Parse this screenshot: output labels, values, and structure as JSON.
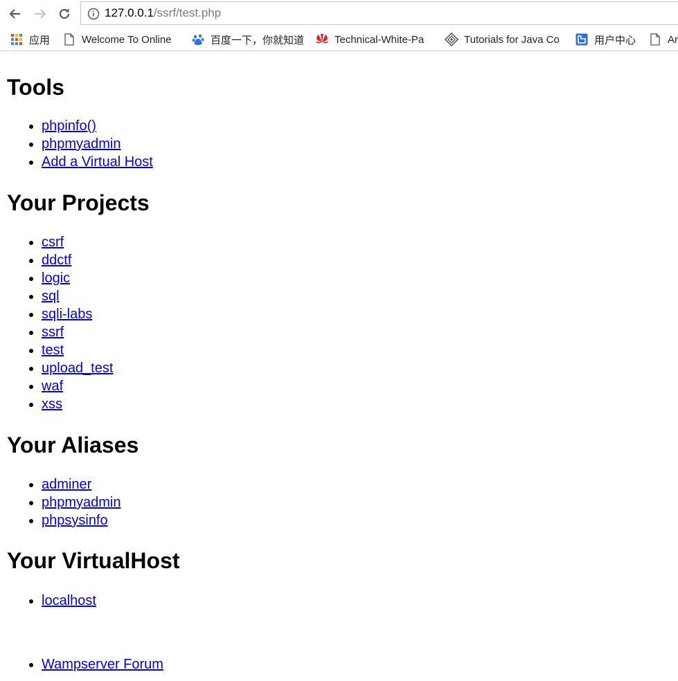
{
  "browser": {
    "url_host": "127.0.0.1",
    "url_path": "/ssrf/test.php",
    "bookmarks": [
      {
        "label": "应用",
        "icon": "apps-grid-icon"
      },
      {
        "label": "Welcome To Online",
        "icon": "page-icon"
      },
      {
        "label": "百度一下，你就知道",
        "icon": "baidu-paw-icon"
      },
      {
        "label": "Technical-White-Pa",
        "icon": "huawei-icon"
      },
      {
        "label": "Tutorials for Java Co",
        "icon": "diamond-icon"
      },
      {
        "label": "用户中心",
        "icon": "user-center-icon"
      },
      {
        "label": "Ar",
        "icon": "page-icon"
      }
    ]
  },
  "page": {
    "tools_heading": "Tools",
    "tools": [
      "phpinfo()",
      "phpmyadmin",
      "Add a Virtual Host"
    ],
    "projects_heading": "Your Projects",
    "projects": [
      "csrf",
      "ddctf",
      "logic",
      "sql",
      "sqli-labs",
      "ssrf",
      "test",
      "upload_test",
      "waf",
      "xss"
    ],
    "aliases_heading": "Your Aliases",
    "aliases": [
      "adminer",
      "phpmyadmin",
      "phpsysinfo"
    ],
    "vhost_heading": "Your VirtualHost",
    "vhosts": [
      "localhost"
    ],
    "forum": "Wampserver Forum"
  },
  "colors": {
    "link": "#0000ee",
    "url_path": "#7a7a7a"
  }
}
